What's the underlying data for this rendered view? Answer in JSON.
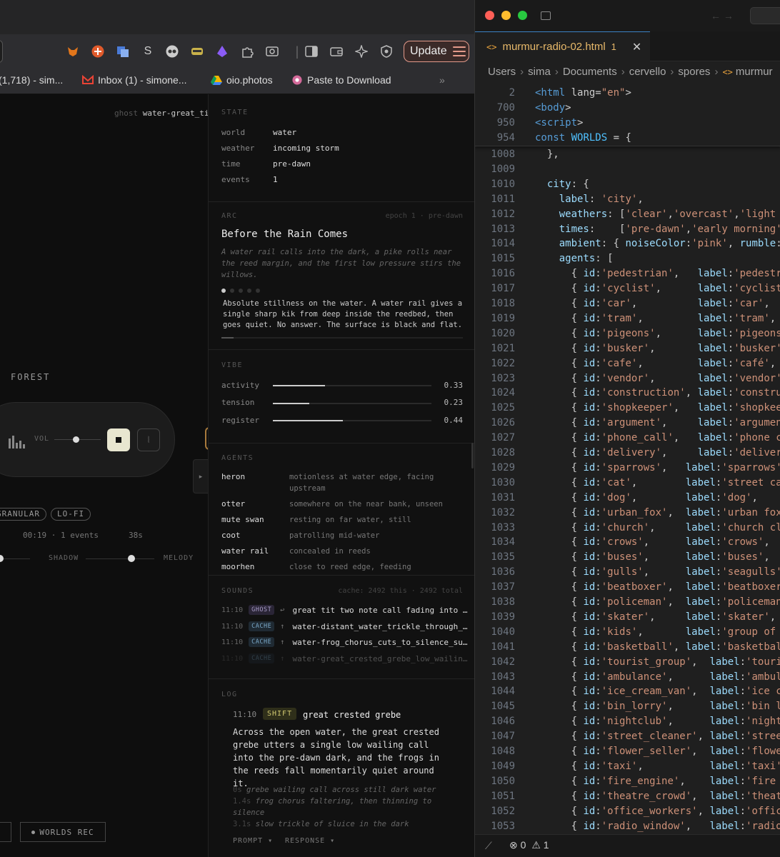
{
  "browser": {
    "update_label": "Update",
    "bookmarks": [
      {
        "label": "(1,718) - sim..."
      },
      {
        "label": "Inbox (1) - simone..."
      },
      {
        "label": "oio.photos"
      },
      {
        "label": "Paste to Download"
      }
    ],
    "bookmarks_overflow": "»"
  },
  "app": {
    "ghost_prefix": "ghost",
    "ghost_name": "water-great_tit",
    "world_label": "FOREST",
    "vol_label": "VOL",
    "volume": 0.4,
    "chips": [
      "GRANULAR",
      "LO-FI"
    ],
    "elapsed": "00:19 · 1 events",
    "remaining": "38s",
    "mix_labels": [
      "SHADOW",
      "MELODY"
    ],
    "rec_label": "WORLDS REC"
  },
  "state": {
    "heading": "STATE",
    "rows": [
      {
        "k": "world",
        "v": "water"
      },
      {
        "k": "weather",
        "v": "incoming storm"
      },
      {
        "k": "time",
        "v": "pre-dawn"
      },
      {
        "k": "events",
        "v": "1"
      }
    ]
  },
  "arc": {
    "heading": "ARC",
    "meta": "epoch 1 · pre-dawn",
    "title": "Before the Rain Comes",
    "description": "A water rail calls into the dark, a pike rolls near the reed margin, and the first low pressure stirs the willows.",
    "text": "Absolute stillness on the water. A water rail gives a single sharp kik from deep inside the reedbed, then goes quiet. No answer. The surface is black and flat.",
    "progress": 0.05
  },
  "vibe": {
    "heading": "VIBE",
    "rows": [
      {
        "k": "activity",
        "v": "0.33",
        "n": 0.33
      },
      {
        "k": "tension",
        "v": "0.23",
        "n": 0.23
      },
      {
        "k": "register",
        "v": "0.44",
        "n": 0.44
      }
    ]
  },
  "agents": {
    "heading": "AGENTS",
    "rows": [
      {
        "k": "heron",
        "v": "motionless at water edge, facing upstream"
      },
      {
        "k": "otter",
        "v": "somewhere on the near bank, unseen"
      },
      {
        "k": "mute swan",
        "v": "resting on far water, still"
      },
      {
        "k": "coot",
        "v": "patrolling mid-water"
      },
      {
        "k": "water rail",
        "v": "concealed in reeds"
      },
      {
        "k": "moorhen",
        "v": "close to reed edge, feeding"
      }
    ]
  },
  "sounds": {
    "heading": "SOUNDS",
    "meta": "cache: 2492 this · 2492 total",
    "rows": [
      {
        "t": "11:10",
        "tag": "GHOST",
        "arrow": "↩",
        "name": "great tit two note call fading into s..."
      },
      {
        "t": "11:10",
        "tag": "CACHE",
        "arrow": "↑",
        "name": "water-distant_water_trickle_through_s..."
      },
      {
        "t": "11:10",
        "tag": "CACHE",
        "arrow": "↑",
        "name": "water-frog_chorus_cuts_to_silence_sud..."
      },
      {
        "t": "11:10",
        "tag": "CACHE",
        "arrow": "↑",
        "name": "water-great_crested_grebe_low_wailing..."
      }
    ]
  },
  "log": {
    "heading": "LOG",
    "time": "11:10",
    "tag": "SHIFT",
    "head": "great crested grebe",
    "body": "Across the open water, the great crested grebe utters a single low wailing call into the pre-dawn dark, and the frogs in the reeds fall momentarily quiet around it.",
    "steps": [
      {
        "ts": "0s",
        "txt": "grebe wailing call across still dark water"
      },
      {
        "ts": "1.4s",
        "txt": "frog chorus faltering, then thinning to silence"
      },
      {
        "ts": "3.1s",
        "txt": "slow trickle of sluice in the dark"
      }
    ],
    "footer": [
      "PROMPT ▾",
      "RESPONSE ▾"
    ]
  },
  "editor": {
    "tab": {
      "name": "murmur-radio-02.html",
      "problems": "1"
    },
    "breadcrumbs": [
      "Users",
      "sima",
      "Documents",
      "cervello",
      "spores",
      "murmur"
    ],
    "status": {
      "errors": "0",
      "warnings": "1"
    },
    "sticky": [
      {
        "n": "2",
        "code": "<html lang=\"en\">"
      },
      {
        "n": "700",
        "code": "<body>"
      },
      {
        "n": "950",
        "code": "<script>"
      },
      {
        "n": "954",
        "code": "const WORLDS = {"
      }
    ],
    "lines": [
      {
        "n": "1008",
        "code": "  },"
      },
      {
        "n": "1009",
        "code": ""
      },
      {
        "n": "1010",
        "code": "  city: {"
      },
      {
        "n": "1011",
        "code": "    label: 'city',"
      },
      {
        "n": "1012",
        "code": "    weathers: ['clear','overcast','light"
      },
      {
        "n": "1013",
        "code": "    times:    ['pre-dawn','early morning'"
      },
      {
        "n": "1014",
        "code": "    ambient: { noiseColor:'pink', rumble:"
      },
      {
        "n": "1015",
        "code": "    agents: ["
      },
      {
        "n": "1016",
        "code": "      { id:'pedestrian',   label:'pedestr"
      },
      {
        "n": "1017",
        "code": "      { id:'cyclist',      label:'cyclist"
      },
      {
        "n": "1018",
        "code": "      { id:'car',          label:'car',"
      },
      {
        "n": "1019",
        "code": "      { id:'tram',         label:'tram',"
      },
      {
        "n": "1020",
        "code": "      { id:'pigeons',      label:'pigeons"
      },
      {
        "n": "1021",
        "code": "      { id:'busker',       label:'busker'"
      },
      {
        "n": "1022",
        "code": "      { id:'cafe',         label:'café',"
      },
      {
        "n": "1023",
        "code": "      { id:'vendor',       label:'vendor'"
      },
      {
        "n": "1024",
        "code": "      { id:'construction', label:'constru"
      },
      {
        "n": "1025",
        "code": "      { id:'shopkeeper',   label:'shopkee"
      },
      {
        "n": "1026",
        "code": "      { id:'argument',     label:'argumen"
      },
      {
        "n": "1027",
        "code": "      { id:'phone_call',   label:'phone c"
      },
      {
        "n": "1028",
        "code": "      { id:'delivery',     label:'deliver"
      },
      {
        "n": "1029",
        "code": "      { id:'sparrows',   label:'sparrows'"
      },
      {
        "n": "1030",
        "code": "      { id:'cat',        label:'street ca"
      },
      {
        "n": "1031",
        "code": "      { id:'dog',        label:'dog',"
      },
      {
        "n": "1032",
        "code": "      { id:'urban_fox',  label:'urban fox"
      },
      {
        "n": "1033",
        "code": "      { id:'church',     label:'church cl"
      },
      {
        "n": "1034",
        "code": "      { id:'crows',      label:'crows',"
      },
      {
        "n": "1035",
        "code": "      { id:'buses',      label:'buses',"
      },
      {
        "n": "1036",
        "code": "      { id:'gulls',      label:'seagulls'"
      },
      {
        "n": "1037",
        "code": "      { id:'beatboxer',  label:'beatboxer"
      },
      {
        "n": "1038",
        "code": "      { id:'policeman',  label:'policeman"
      },
      {
        "n": "1039",
        "code": "      { id:'skater',     label:'skater',"
      },
      {
        "n": "1040",
        "code": "      { id:'kids',       label:'group of"
      },
      {
        "n": "1041",
        "code": "      { id:'basketball', label:'basketbal"
      },
      {
        "n": "1042",
        "code": "      { id:'tourist_group',  label:'touri"
      },
      {
        "n": "1043",
        "code": "      { id:'ambulance',      label:'ambul"
      },
      {
        "n": "1044",
        "code": "      { id:'ice_cream_van',  label:'ice c"
      },
      {
        "n": "1045",
        "code": "      { id:'bin_lorry',      label:'bin l"
      },
      {
        "n": "1046",
        "code": "      { id:'nightclub',      label:'night"
      },
      {
        "n": "1047",
        "code": "      { id:'street_cleaner', label:'stree"
      },
      {
        "n": "1048",
        "code": "      { id:'flower_seller',  label:'flowe"
      },
      {
        "n": "1049",
        "code": "      { id:'taxi',           label:'taxi'"
      },
      {
        "n": "1050",
        "code": "      { id:'fire_engine',    label:'fire"
      },
      {
        "n": "1051",
        "code": "      { id:'theatre_crowd',  label:'theat"
      },
      {
        "n": "1052",
        "code": "      { id:'office_workers', label:'offic"
      },
      {
        "n": "1053",
        "code": "      { id:'radio_window',   label:'radio"
      }
    ]
  }
}
